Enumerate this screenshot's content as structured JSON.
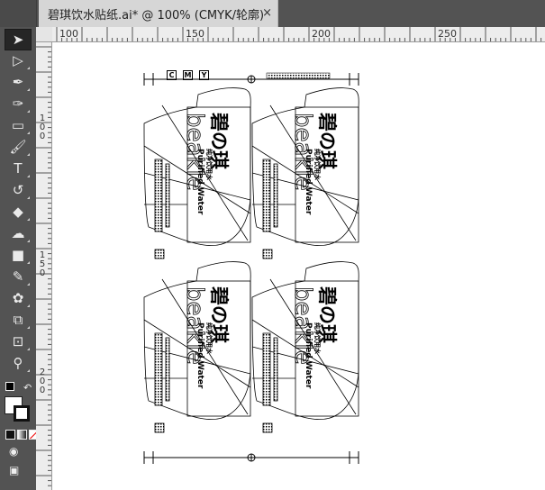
{
  "document": {
    "tab_title": "碧琪饮水贴纸.ai* @ 100% (CMYK/轮廓)",
    "close_glyph": "×"
  },
  "rulers": {
    "horizontal": [
      "100",
      "150",
      "200",
      "250"
    ],
    "vertical": [
      [
        "1",
        "0",
        "0"
      ],
      [
        "1",
        "5",
        "0"
      ],
      [
        "2",
        "0",
        "0"
      ]
    ]
  },
  "tools": [
    {
      "name": "selection-tool",
      "icon": "arrow-icon",
      "glyph": "➤",
      "active": true
    },
    {
      "name": "direct-selection-tool",
      "icon": "hollow-arrow-icon",
      "glyph": "▷"
    },
    {
      "name": "pen-tool",
      "icon": "pen-icon",
      "glyph": "✒"
    },
    {
      "name": "curvature-tool",
      "icon": "curvature-pen-icon",
      "glyph": "✑"
    },
    {
      "name": "rectangle-tool",
      "icon": "rectangle-icon",
      "glyph": "▭"
    },
    {
      "name": "paintbrush-tool",
      "icon": "brush-icon",
      "glyph": "🖌"
    },
    {
      "name": "type-tool",
      "icon": "type-icon",
      "glyph": "T"
    },
    {
      "name": "rotate-tool",
      "icon": "rotate-icon",
      "glyph": "↺"
    },
    {
      "name": "eraser-tool",
      "icon": "eraser-icon",
      "glyph": "◆"
    },
    {
      "name": "warp-tool",
      "icon": "warp-icon",
      "glyph": "☁"
    },
    {
      "name": "gradient-tool",
      "icon": "gradient-icon",
      "glyph": "■"
    },
    {
      "name": "eyedropper-tool",
      "icon": "eyedropper-icon",
      "glyph": "✎"
    },
    {
      "name": "blend-tool",
      "icon": "blend-icon",
      "glyph": "✿"
    },
    {
      "name": "shape-builder-tool",
      "icon": "shape-builder-icon",
      "glyph": "⧉"
    },
    {
      "name": "artboard-tool",
      "icon": "artboard-icon",
      "glyph": "⊡"
    },
    {
      "name": "zoom-tool",
      "icon": "zoom-icon",
      "glyph": "⚲"
    }
  ],
  "sticker": {
    "brand_cn": "碧の琪",
    "brand_en": "beakie",
    "product_cn": "纯净饮用水",
    "product_en": "Purified Water"
  },
  "registration_marks": [
    "C",
    "M",
    "Y"
  ],
  "colors": {
    "panel": "#535353",
    "ruler": "#ededed",
    "tab": "#d6d6d6",
    "canvas": "#ffffff",
    "outline": "#000000"
  }
}
